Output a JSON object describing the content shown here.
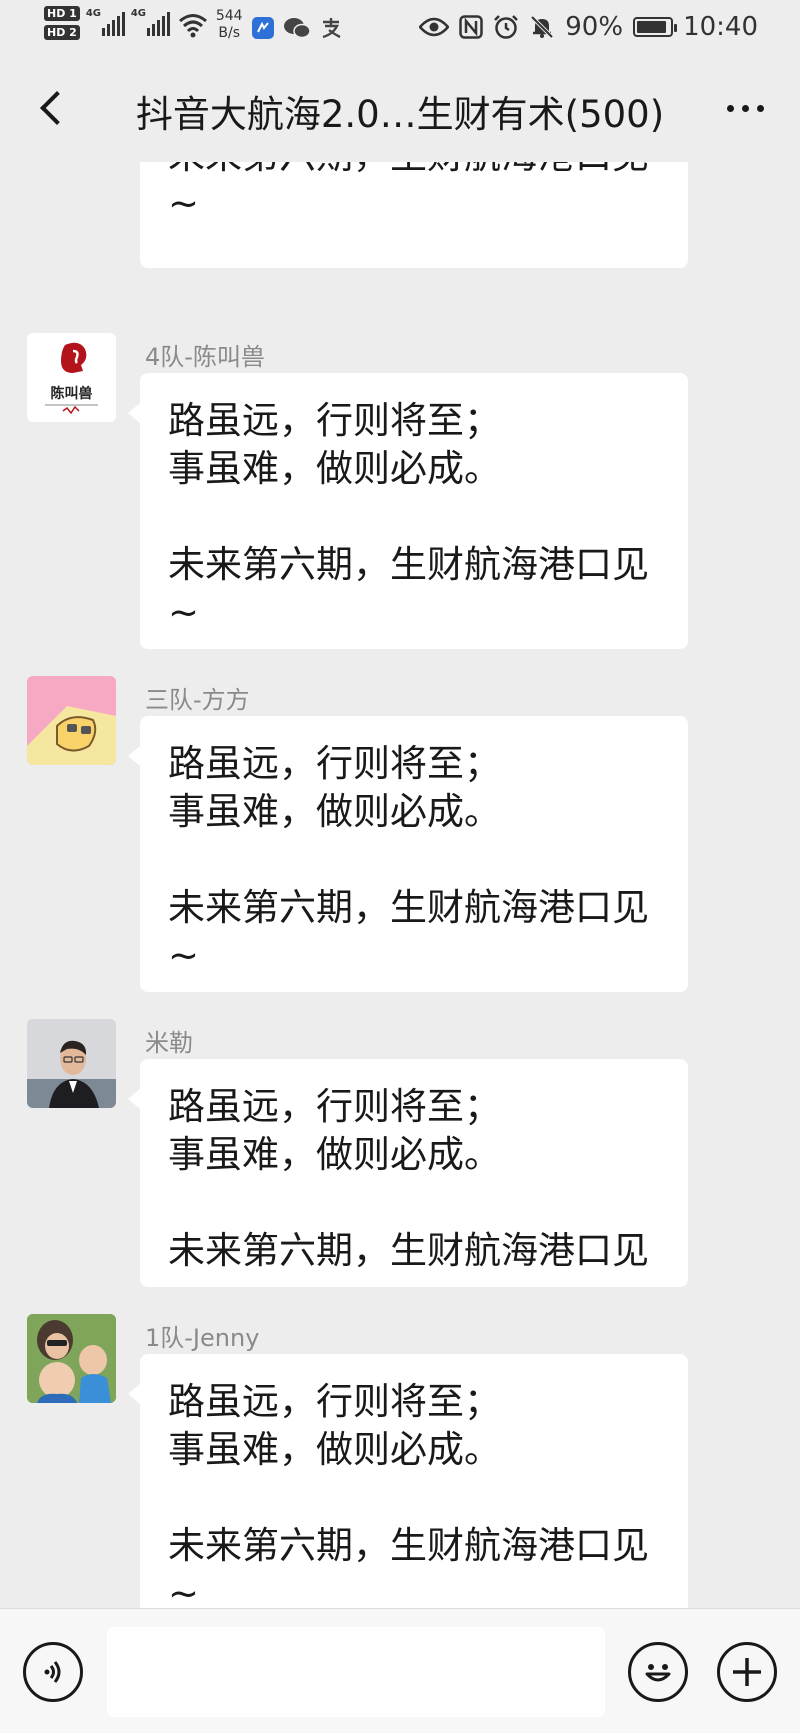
{
  "status_bar": {
    "hd1": "HD 1",
    "hd2": "HD 2",
    "net1": "4G",
    "net2": "4G",
    "speed_value": "544",
    "speed_unit": "B/s",
    "battery_level_percent": 90,
    "battery_text": "90%",
    "time": "10:40"
  },
  "header": {
    "title": "抖音大航海2.0…生财有术(500)"
  },
  "messages": [
    {
      "sender": "",
      "text": "未来第六期，生财航海港口见\n~"
    },
    {
      "sender": "4队-陈叫兽",
      "text": "路虽远，行则将至；\n事虽难，做则必成。\n\n未来第六期，生财航海港口见\n~",
      "avatar_text": "陈叫兽"
    },
    {
      "sender": "三队-方方",
      "text": "路虽远，行则将至；\n事虽难，做则必成。\n\n未来第六期，生财航海港口见\n~"
    },
    {
      "sender": "米勒",
      "text": "路虽远，行则将至；\n事虽难，做则必成。\n\n未来第六期，生财航海港口见"
    },
    {
      "sender": "1队-Jenny",
      "text": "路虽远，行则将至；\n事虽难，做则必成。\n\n未来第六期，生财航海港口见\n~"
    }
  ],
  "input_bar": {
    "text_value": ""
  },
  "colors": {
    "background": "#ededed",
    "bubble": "#ffffff",
    "sender_name": "#8a8a8a"
  }
}
